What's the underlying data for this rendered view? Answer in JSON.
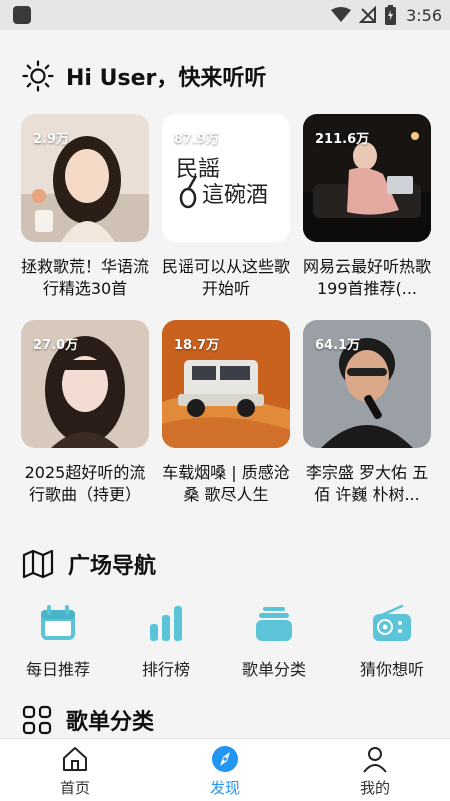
{
  "status_bar": {
    "time": "3:56"
  },
  "greeting": {
    "text": "Hi User，快来听听"
  },
  "playlists": [
    {
      "count": "2.9万",
      "title": "拯救歌荒！华语流行精选30首",
      "icon": "portrait-photo"
    },
    {
      "count": "87.9万",
      "title": "民谣可以从这些歌开始听",
      "cover_text": "民謡\n這碗酒",
      "icon": "calligraphy-guitar"
    },
    {
      "count": "211.6万",
      "title": "网易云最好听热歌199首推荐(...",
      "icon": "sofa-photo"
    },
    {
      "count": "27.0万",
      "title": "2025超好听的流行歌曲（持更）",
      "icon": "portrait-photo"
    },
    {
      "count": "18.7万",
      "title": "车载烟嗓 | 质感沧桑 歌尽人生",
      "icon": "car-desert-photo"
    },
    {
      "count": "64.1万",
      "title": "李宗盛 罗大佑 五佰 许巍 朴树...",
      "icon": "singer-photo"
    }
  ],
  "square_nav": {
    "title": "广场导航",
    "icon": "map-icon",
    "items": [
      {
        "label": "每日推荐",
        "icon": "calendar-icon"
      },
      {
        "label": "排行榜",
        "icon": "bar-chart-icon"
      },
      {
        "label": "歌单分类",
        "icon": "stack-icon"
      },
      {
        "label": "猜你想听",
        "icon": "radio-icon"
      }
    ]
  },
  "category_section": {
    "title": "歌单分类",
    "icon": "grid-icon"
  },
  "tab_bar": {
    "tabs": [
      {
        "label": "首页",
        "icon": "home-icon",
        "active": false
      },
      {
        "label": "发现",
        "icon": "compass-icon",
        "active": true
      },
      {
        "label": "我的",
        "icon": "user-icon",
        "active": false
      }
    ]
  },
  "colors": {
    "accent": "#2196f3",
    "nav_icon": "#5bc4d8",
    "background": "#f4f4f4"
  }
}
